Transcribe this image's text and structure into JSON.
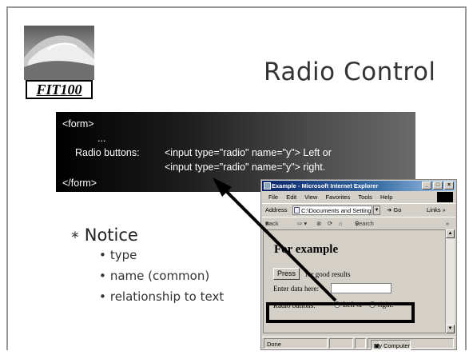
{
  "slide": {
    "logo_text": "FIT100",
    "title": "Radio Control"
  },
  "code": {
    "line1": "<form>",
    "line2": "...",
    "line3_label": "Radio buttons:",
    "line3_code": "<input type=\"radio\" name=\"y\"> Left or",
    "line4_code": "<input type=\"radio\" name=\"y\"> right.",
    "line5": "</form>"
  },
  "bullets": {
    "main": "Notice",
    "items": [
      "type",
      "name (common)",
      "relationship to text"
    ]
  },
  "ie": {
    "title": "Example - Microsoft Internet Explorer",
    "menu": [
      "File",
      "Edit",
      "View",
      "Favorites",
      "Tools",
      "Help"
    ],
    "address_label": "Address",
    "address_value": "C:\\Documents and Setting",
    "go_label": "Go",
    "links_label": "Links",
    "nav_back": "Back",
    "nav_search": "Search",
    "page": {
      "heading": "For example",
      "press_button": "Press",
      "press_text": "for good results",
      "enter_label": "Enter data here:",
      "radio_label": "Radio buttons:",
      "radio_left": "Left or",
      "radio_right": "right."
    },
    "status_done": "Done",
    "status_zone": "My Computer"
  },
  "icons": [
    "wave-logo-icon",
    "ie-app-icon",
    "minimize-icon",
    "maximize-icon",
    "close-icon",
    "back-icon",
    "forward-icon",
    "stop-icon",
    "refresh-icon",
    "home-icon",
    "search-icon",
    "arrow-icon"
  ],
  "colors": {
    "title_bar": "#0a246a",
    "window_face": "#d4d0c8",
    "code_bg": "#000000"
  }
}
